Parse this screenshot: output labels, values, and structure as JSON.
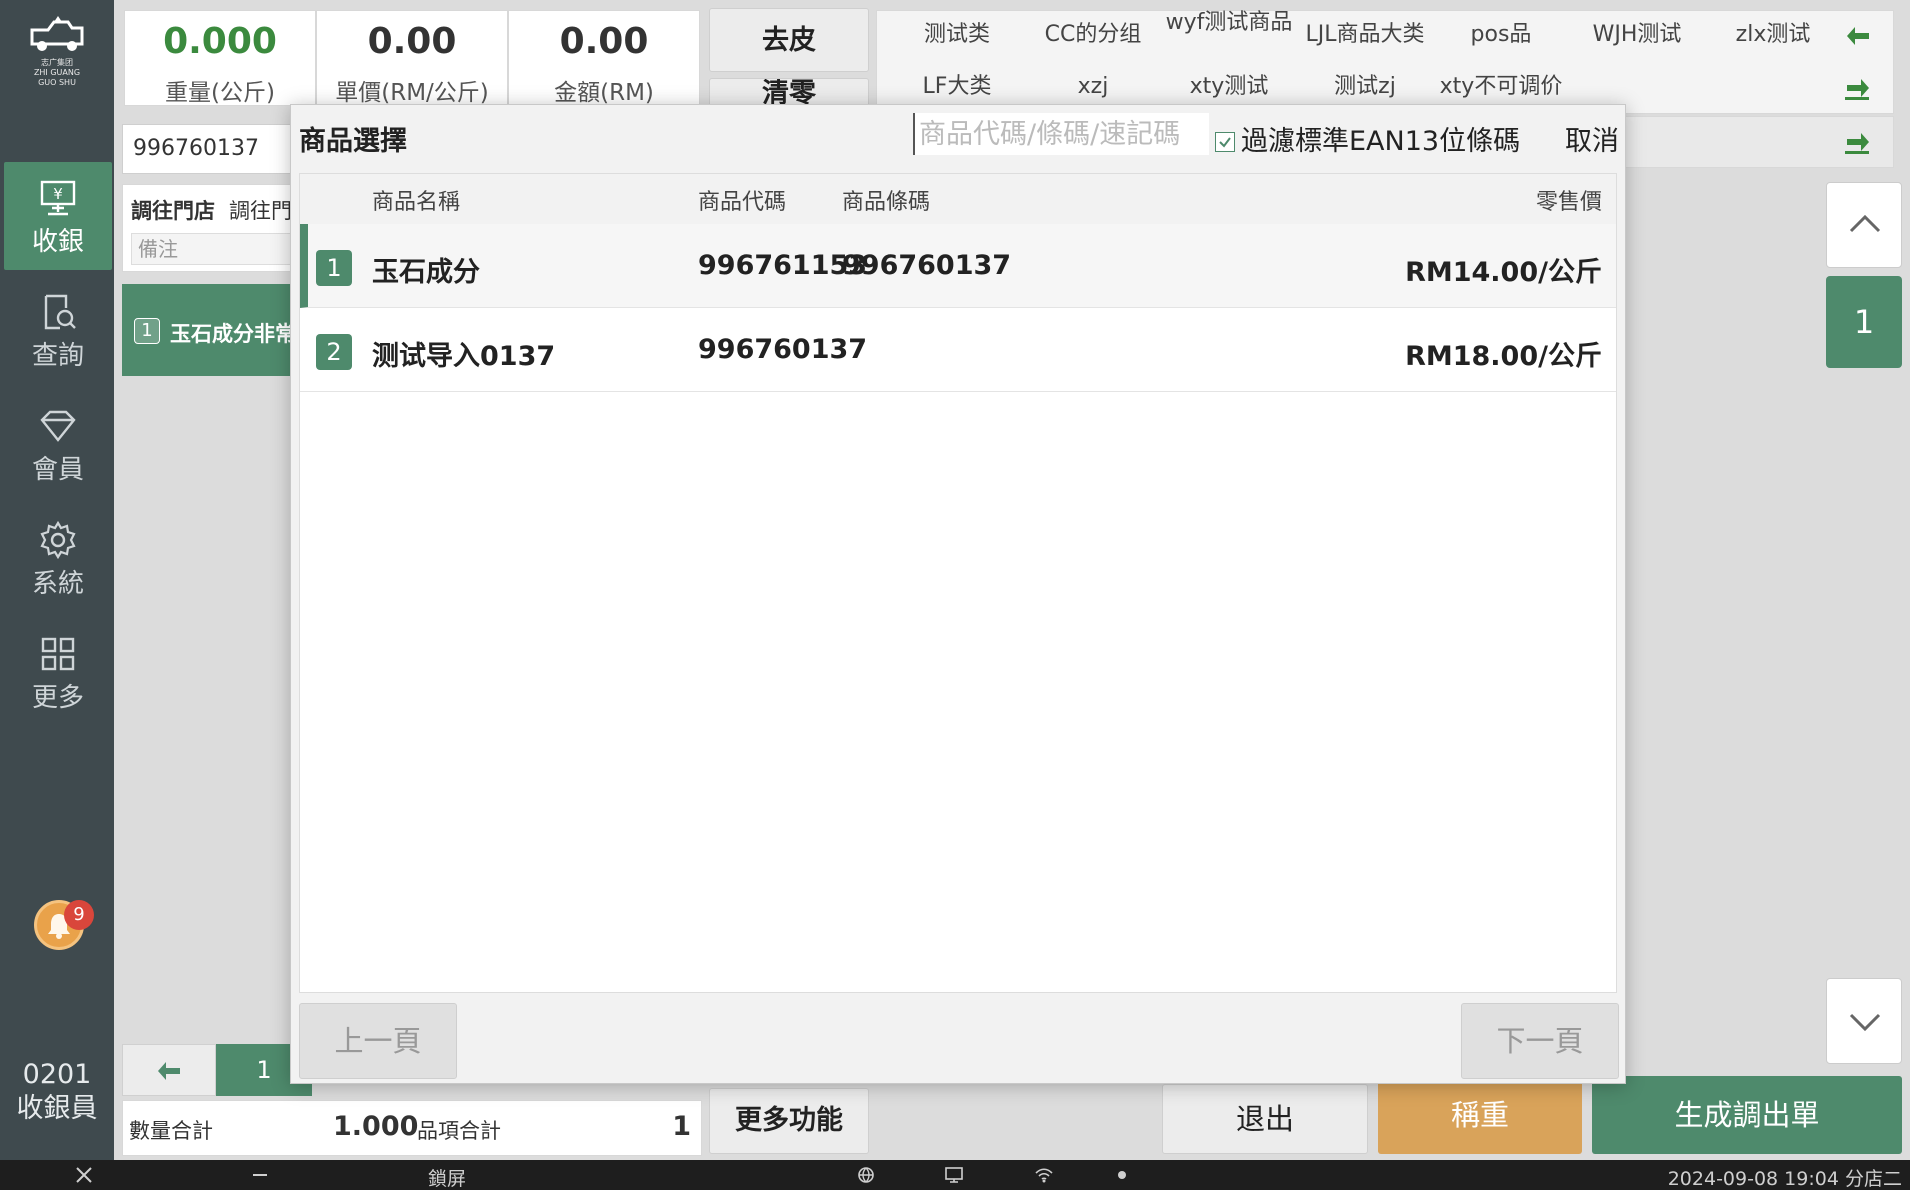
{
  "logo": {
    "sub_text": "志广集团\nZHI GUANG GUO SHU"
  },
  "sidebar": {
    "items": [
      {
        "label": "收銀",
        "icon": "cashier-icon",
        "active": true
      },
      {
        "label": "查詢",
        "icon": "search-doc-icon",
        "active": false
      },
      {
        "label": "會員",
        "icon": "diamond-icon",
        "active": false
      },
      {
        "label": "系統",
        "icon": "gear-icon",
        "active": false
      },
      {
        "label": "更多",
        "icon": "grid-icon",
        "active": false
      }
    ],
    "notification_count": "9",
    "cashier_id": "0201",
    "cashier_role": "收銀員"
  },
  "metrics": [
    {
      "value": "0.000",
      "label": "重量(公斤)"
    },
    {
      "value": "0.00",
      "label": "單價(RM/公斤)"
    },
    {
      "value": "0.00",
      "label": "金額(RM)"
    }
  ],
  "actions": {
    "tare": "去皮",
    "tare_partial": "清零"
  },
  "categories": {
    "row1": [
      "测试类",
      "CC的分组",
      "wyf测试商品",
      "LJL商品大类",
      "pos品",
      "WJH测试",
      "zlx测试"
    ],
    "row2": [
      "LF大类",
      "xzj",
      "xty测试",
      "测试zj",
      "xty不可调价"
    ]
  },
  "left_panel": {
    "barcode_input": "996760137",
    "store_label": "調往門店",
    "store_value": "調往門",
    "remark_placeholder": "備注",
    "cart_item_num": "1",
    "cart_item_name": "玉石成分非常",
    "page": "1",
    "qty_total_label": "數量合計",
    "qty_total_value": "1.000",
    "items_total_label": "品項合計",
    "items_total_value": "1",
    "more_functions": "更多功能"
  },
  "right_panel": {
    "page_indicator": "1"
  },
  "bottom_actions": {
    "exit": "退出",
    "weigh": "稱重",
    "generate": "生成調出單"
  },
  "modal": {
    "title": "商品選擇",
    "search_placeholder": "商品代碼/條碼/速記碼",
    "filter_label": "過濾標準EAN13位條碼",
    "filter_checked": true,
    "cancel": "取消",
    "columns": {
      "name": "商品名稱",
      "code": "商品代碼",
      "barcode": "商品條碼",
      "price": "零售價"
    },
    "rows": [
      {
        "num": "1",
        "name": "玉石成分",
        "code": "996761153",
        "barcode": "996760137",
        "price": "RM14.00/公斤",
        "selected": true
      },
      {
        "num": "2",
        "name": "测试导入0137",
        "code": "996760137",
        "barcode": "",
        "price": "RM18.00/公斤",
        "selected": false
      }
    ],
    "prev_page": "上一頁",
    "next_page": "下一頁"
  },
  "taskbar": {
    "lock_screen": "鎖屏",
    "datetime": "2024-09-08 19:04",
    "branch": "分店二"
  },
  "colors": {
    "primary_green": "#4e8a6c",
    "weigh_orange": "#d9a35a",
    "sidebar_bg": "#3f4a4e"
  }
}
